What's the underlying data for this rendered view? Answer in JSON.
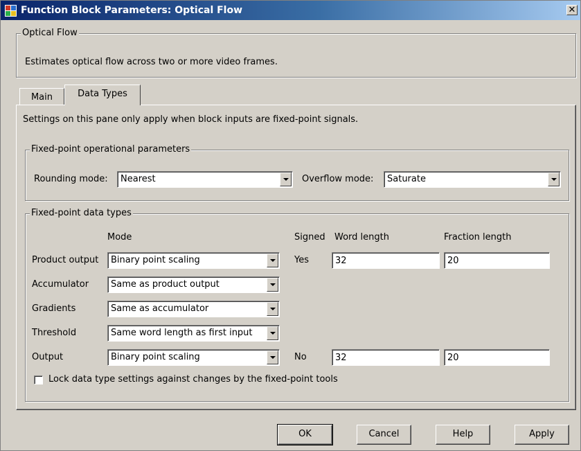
{
  "window": {
    "title": "Function Block Parameters: Optical Flow",
    "close_glyph": "✕"
  },
  "description_group": {
    "legend": "Optical Flow",
    "text": "Estimates optical flow across two or more video frames."
  },
  "tabs": [
    {
      "label": "Main",
      "active": false
    },
    {
      "label": "Data Types",
      "active": true
    }
  ],
  "pane": {
    "note": "Settings on this pane only apply when block inputs are fixed-point signals.",
    "operational": {
      "legend": "Fixed-point operational parameters",
      "rounding_label": "Rounding mode:",
      "rounding_value": "Nearest",
      "overflow_label": "Overflow mode:",
      "overflow_value": "Saturate"
    },
    "datatypes": {
      "legend": "Fixed-point data types",
      "headers": {
        "mode": "Mode",
        "signed": "Signed",
        "word_length": "Word length",
        "fraction_length": "Fraction length"
      },
      "rows": [
        {
          "label": "Product output",
          "mode": "Binary point scaling",
          "signed": "Yes",
          "word_length": "32",
          "fraction_length": "20"
        },
        {
          "label": "Accumulator",
          "mode": "Same as product output"
        },
        {
          "label": "Gradients",
          "mode": "Same as accumulator"
        },
        {
          "label": "Threshold",
          "mode": "Same word length as first input"
        },
        {
          "label": "Output",
          "mode": "Binary point scaling",
          "signed": "No",
          "word_length": "32",
          "fraction_length": "20"
        }
      ],
      "lock_label": "Lock data type settings against changes by the fixed-point tools",
      "lock_checked": false
    }
  },
  "buttons": {
    "ok": "OK",
    "cancel": "Cancel",
    "help": "Help",
    "apply": "Apply"
  },
  "colors": {
    "dialog_bg": "#d4d0c8",
    "title_start": "#0a246a",
    "title_end": "#a6caf0"
  }
}
